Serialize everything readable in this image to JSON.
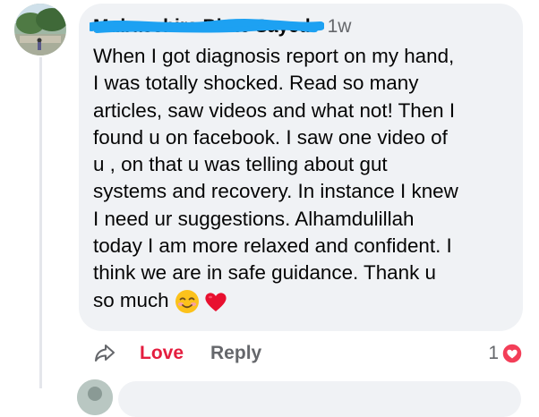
{
  "comment": {
    "author": "Mubasshira Binte Sayed",
    "separator": "·",
    "time": "1w",
    "text_lines": [
      "When I got diagnosis report on my hand,",
      "I was totally shocked. Read so many",
      "articles, saw videos and what not! Then I",
      "found u on facebook. I saw one video of",
      "u , on that u was telling about gut",
      "systems and recovery. In instance I knew",
      "I need ur suggestions. Alhamdulillah",
      "today I am more relaxed and confident. I",
      "think we are in safe guidance. Thank u",
      "so much"
    ],
    "emojis": [
      "smiling-face-icon",
      "red-heart-icon"
    ]
  },
  "actions": {
    "share_icon": "share-icon",
    "love_label": "Love",
    "reply_label": "Reply"
  },
  "reactions": {
    "count": "1",
    "icon": "love-reaction-icon"
  },
  "colors": {
    "bubble": "#f0f2f5",
    "love": "#e41e3f",
    "secondary_text": "#65676b",
    "redaction": "#1da1f2"
  }
}
